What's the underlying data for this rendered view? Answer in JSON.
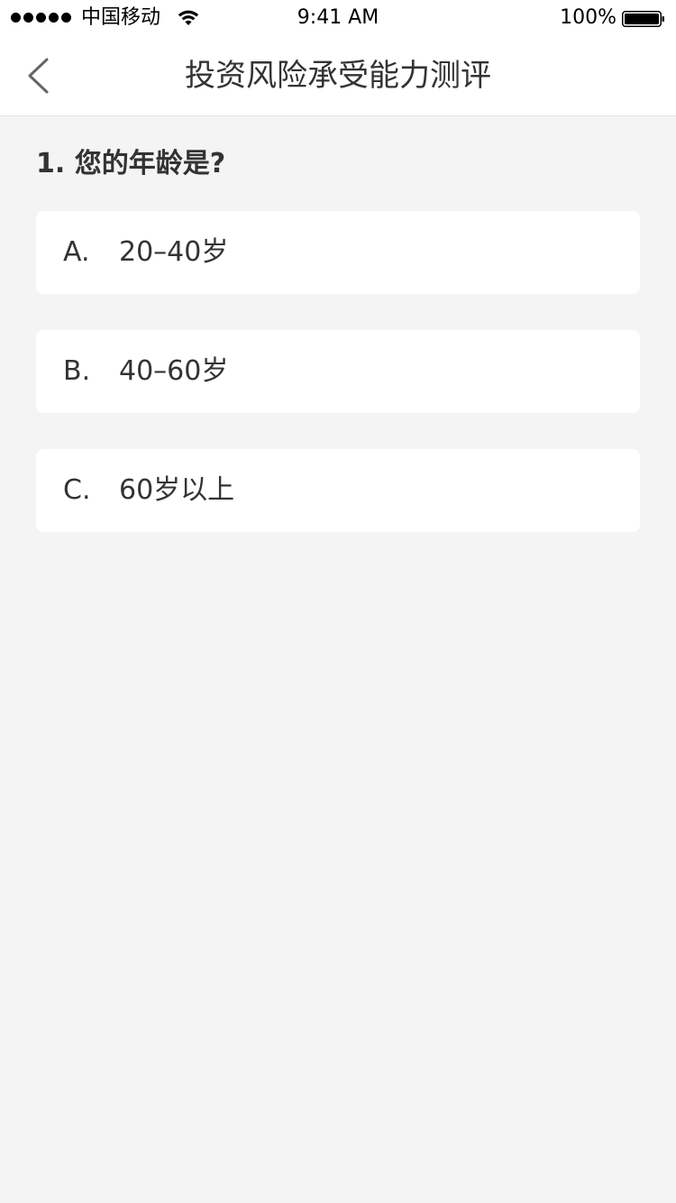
{
  "status_bar": {
    "carrier": "中国移动",
    "time": "9:41 AM",
    "battery": "100%"
  },
  "nav": {
    "title": "投资风险承受能力测评",
    "back_icon": "chevron-left-icon"
  },
  "question": {
    "text": "1. 您的年龄是?",
    "options": [
      {
        "letter": "A.",
        "text": "20–40岁"
      },
      {
        "letter": "B.",
        "text": "40–60岁"
      },
      {
        "letter": "C.",
        "text": "60岁以上"
      }
    ]
  },
  "colors": {
    "background": "#f4f4f4",
    "card": "#ffffff",
    "text": "#333333"
  }
}
